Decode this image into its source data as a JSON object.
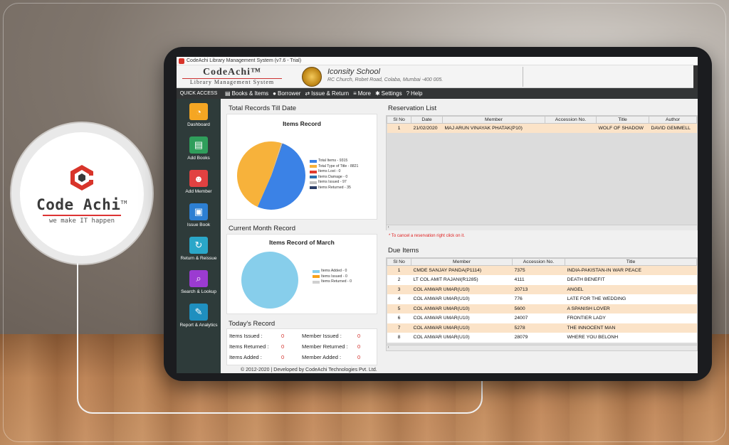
{
  "window": {
    "title": "CodeAchi Library Management System (v7.6 - Trial)"
  },
  "brand": {
    "name": "CodeAchi™",
    "subtitle": "Library Management System"
  },
  "school": {
    "name": "Iconsity School",
    "address": "RC Church, Robet Road, Colaba, Mumbai -400 005."
  },
  "nav": {
    "quick_access": "QUICK ACCESS",
    "items": [
      "Books & Items",
      "Borrower",
      "Issue & Return",
      "More",
      "Settings",
      "Help"
    ]
  },
  "sidebar": {
    "items": [
      {
        "label": "Dashboard",
        "color": "#f5a623",
        "icon": "dashboard-icon"
      },
      {
        "label": "Add Books",
        "color": "#2f9e5b",
        "icon": "books-icon"
      },
      {
        "label": "Add Member",
        "color": "#e24141",
        "icon": "member-icon"
      },
      {
        "label": "Issue Book",
        "color": "#2d7fd3",
        "icon": "issue-icon"
      },
      {
        "label": "Return & Reissue",
        "color": "#2aa7c9",
        "icon": "return-icon"
      },
      {
        "label": "Search & Lookup",
        "color": "#9b3bd1",
        "icon": "search-icon"
      },
      {
        "label": "Report & Analytics",
        "color": "#1f8fbf",
        "icon": "report-icon"
      }
    ]
  },
  "total_records": {
    "section_title": "Total Records Till Date",
    "chart_title": "Items Record"
  },
  "current_month": {
    "section_title": "Current Month Record",
    "chart_title": "Items Record of March"
  },
  "chart_data": [
    {
      "type": "pie",
      "title": "Items Record",
      "categories": [
        "Total Items - 9315",
        "Total Type of Title - 8821",
        "Items Lost - 0",
        "Items Damage - 0",
        "Items Issued - 97",
        "Items Returned - 35"
      ],
      "values": [
        9315,
        8821,
        0,
        0,
        97,
        35
      ],
      "colors": [
        "#3b82e6",
        "#f7b23b",
        "#e23b2e",
        "#2a6fb0",
        "#c0c0c0",
        "#2c3e66"
      ],
      "legend": "right"
    },
    {
      "type": "pie",
      "title": "Items Record of March",
      "categories": [
        "Items Added - 0",
        "Items Issued - 0",
        "Items Returned - 0"
      ],
      "values": [
        0,
        0,
        0
      ],
      "colors": [
        "#87ceeb",
        "#f7a21b",
        "#d0d0d0"
      ],
      "legend": "right"
    }
  ],
  "today": {
    "section_title": "Today's Record",
    "rows": [
      {
        "l1": "Items Issued :",
        "v1": "0",
        "l2": "Member Issued :",
        "v2": "0"
      },
      {
        "l1": "Items Returned :",
        "v1": "0",
        "l2": "Member Returned :",
        "v2": "0"
      },
      {
        "l1": "Items Added :",
        "v1": "0",
        "l2": "Member Added :",
        "v2": "0"
      }
    ]
  },
  "reservation": {
    "section_title": "Reservation List",
    "columns": [
      "Sl No",
      "Date",
      "Member",
      "Accession No.",
      "Title",
      "Author"
    ],
    "rows": [
      [
        "1",
        "21/02/2020",
        "MAJ ARUN VINAYAK PHATAK(P10)",
        "",
        "WOLF OF SHADOW",
        "DAVID GEMMELL"
      ]
    ],
    "note": "* To cancel a reservation right click on it."
  },
  "due": {
    "section_title": "Due Items",
    "columns": [
      "Sl No",
      "Member",
      "Accession No.",
      "Title"
    ],
    "rows": [
      [
        "1",
        "CMDE SANJAY  PANDA(P1114)",
        "7375",
        "INDIA-PAKISTAN-IN WAR PEACE"
      ],
      [
        "2",
        "LT COL AMIT  RAJANI(R1285)",
        "4111",
        "DEATH BENEFIT"
      ],
      [
        "3",
        "COL ANWAR  UMAR(U10)",
        "20713",
        "ANGEL"
      ],
      [
        "4",
        "COL ANWAR  UMAR(U10)",
        "776",
        "LATE FOR THE WEDDING"
      ],
      [
        "5",
        "COL ANWAR  UMAR(U10)",
        "5600",
        "A SPANISH LOVER"
      ],
      [
        "6",
        "COL ANWAR  UMAR(U10)",
        "24007",
        "FRONTIER LADY"
      ],
      [
        "7",
        "COL ANWAR  UMAR(U10)",
        "5278",
        "THE INNOCENT MAN"
      ],
      [
        "8",
        "COL ANWAR  UMAR(U10)",
        "28079",
        "WHERE YOU BELONH"
      ]
    ]
  },
  "footer": "© 2012-2020 | Developed by CodeAchi Technologies Pvt. Ltd.",
  "promo": {
    "logo_text": "Code Achi",
    "tm": "TM",
    "tagline": "we make IT happen"
  }
}
